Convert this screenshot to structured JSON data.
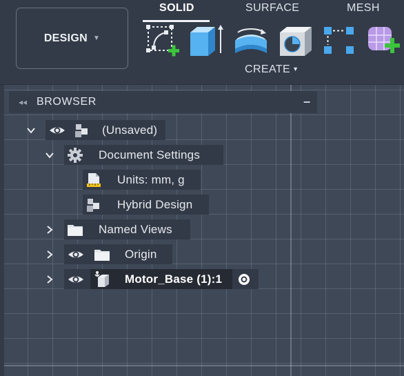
{
  "toolbar": {
    "workspace_label": "DESIGN",
    "tabs": [
      {
        "label": "SOLID",
        "active": true
      },
      {
        "label": "SURFACE",
        "active": false
      },
      {
        "label": "MESH",
        "active": false
      }
    ],
    "group_label": "CREATE",
    "tools": [
      {
        "icon": "create-sketch-icon"
      },
      {
        "icon": "extrude-icon"
      },
      {
        "icon": "revolve-icon"
      },
      {
        "icon": "hole-icon"
      },
      {
        "icon": "pattern-icon"
      },
      {
        "icon": "create-form-icon"
      }
    ]
  },
  "browser": {
    "title": "BROWSER",
    "tree": {
      "root": {
        "label": "(Unsaved)",
        "expanded": true
      },
      "document_settings": {
        "label": "Document Settings",
        "expanded": true
      },
      "units": {
        "label": "Units: mm, g"
      },
      "design_type": {
        "label": "Hybrid Design"
      },
      "named_views": {
        "label": "Named Views",
        "expanded": false
      },
      "origin": {
        "label": "Origin",
        "expanded": false
      },
      "component": {
        "label": "Motor_Base (1):1",
        "expanded": false,
        "active": true
      }
    }
  },
  "colors": {
    "toolbar_bg": "#333b48",
    "canvas_bg": "#3f4857",
    "node_bg": "#333a47",
    "accent_blue": "#4aa8ee",
    "add_green": "#3cc43c"
  }
}
